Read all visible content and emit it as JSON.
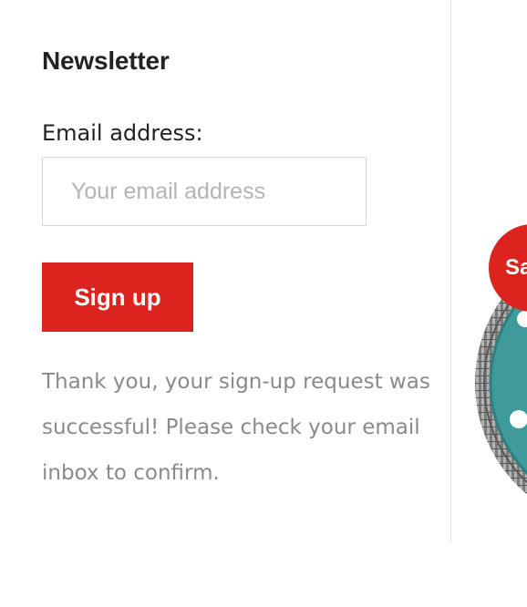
{
  "newsletter": {
    "title": "Newsletter",
    "email_label": "Email address:",
    "email_placeholder": "Your email address",
    "email_value": "",
    "signup_label": "Sign up",
    "success_message": "Thank you, your sign-up request was successful! Please check your email inbox to confirm."
  },
  "product": {
    "badge_text": "Sa",
    "image_icon": "diamond-saw-blade-icon"
  },
  "colors": {
    "accent": "#dc231e",
    "title_text": "#222222",
    "message_text": "#8a8a8a",
    "input_border": "#d6d6d6",
    "blade_teal": "#3f9a9b"
  }
}
